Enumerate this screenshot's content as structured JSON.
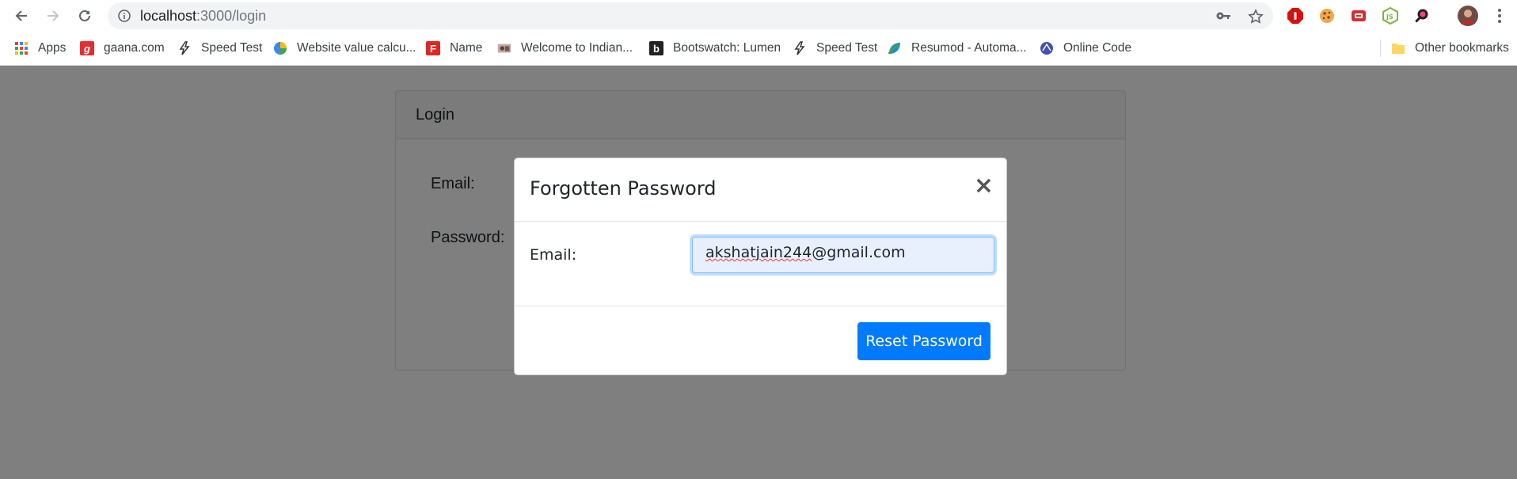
{
  "browser": {
    "url_host": "localhost",
    "url_path": ":3000/login",
    "icons": [
      "back-arrow-icon",
      "forward-arrow-icon",
      "reload-icon",
      "info-icon",
      "key-icon",
      "star-icon"
    ],
    "extensions": [
      "adblock-icon",
      "cookie-icon",
      "red-extension-icon",
      "nodejs-icon",
      "zoom-icon",
      "profile-avatar",
      "menu-icon"
    ],
    "bookmarks": [
      {
        "label": "Apps"
      },
      {
        "label": "gaana.com"
      },
      {
        "label": "Speed Test"
      },
      {
        "label": "Website value calcu..."
      },
      {
        "label": "Name"
      },
      {
        "label": "Welcome to Indian..."
      },
      {
        "label": "Bootswatch: Lumen"
      },
      {
        "label": "Speed Test"
      },
      {
        "label": "Resumod - Automa..."
      },
      {
        "label": "Online Code"
      },
      {
        "label": "Other bookmarks"
      }
    ]
  },
  "page": {
    "card_title": "Login",
    "email_label": "Email:",
    "password_label": "Password:"
  },
  "modal": {
    "title": "Forgotten Password",
    "close_symbol": "×",
    "email_label": "Email:",
    "email_value_user": "akshatjain244",
    "email_value_domain": "@gmail.com",
    "submit_label": "Reset Password"
  },
  "colors": {
    "primary": "#007bff",
    "backdrop": "rgba(0,0,0,0.5)",
    "autofill": "#e8f0fe"
  }
}
